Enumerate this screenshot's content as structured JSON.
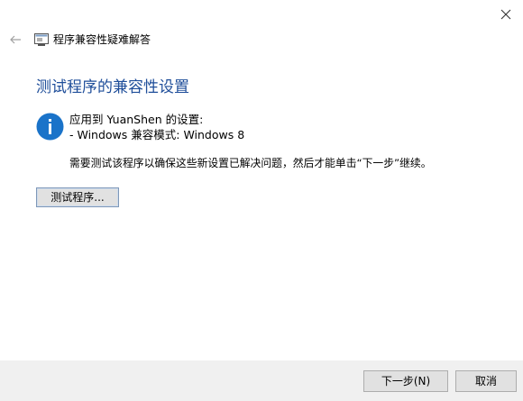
{
  "window": {
    "title": "程序兼容性疑难解答",
    "back_icon": "back-arrow-icon",
    "app_icon": "troubleshooter-app-icon",
    "close_icon": "close-icon"
  },
  "main": {
    "page_title": "测试程序的兼容性设置",
    "info_icon": "info-icon",
    "applied_label": "应用到 YuanShen 的设置:",
    "applied_setting": "- Windows 兼容模式: Windows 8",
    "instruction": "需要测试该程序以确保这些新设置已解决问题，然后才能单击“下一步”继续。",
    "test_button_label": "测试程序..."
  },
  "footer": {
    "next_label": "下一步(N)",
    "cancel_label": "取消"
  },
  "colors": {
    "title_blue": "#1f4e9a",
    "info_blue": "#1a73c9",
    "footer_bg": "#f0f0f0"
  }
}
